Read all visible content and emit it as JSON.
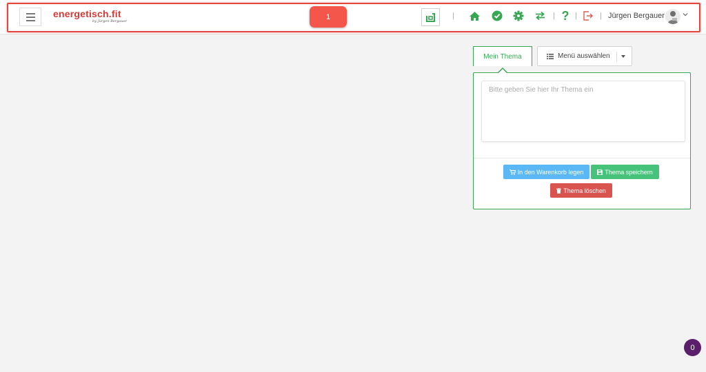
{
  "header": {
    "logo_main": "energetisch.fit",
    "logo_sub": "by Jürgen Bergauer",
    "red_badge": "1",
    "user_name": "Jürgen Bergauer",
    "separator": "|",
    "icons": [
      "menu-icon",
      "square-icon",
      "home-icon",
      "check-circle-icon",
      "gear-icon",
      "swap-icon",
      "question-icon",
      "logout-icon",
      "avatar",
      "chevron-down-icon"
    ]
  },
  "topic": {
    "tab_label": "Mein Thema",
    "menu_select_label": "Menü auswählen",
    "textarea_placeholder": "Bitte geben Sie hier Ihr Thema ein",
    "cart_button": "In den Warenkorb legen",
    "save_button": "Thema speichern",
    "delete_button": "Thema löschen"
  },
  "corner_badge": "0",
  "colors": {
    "accent_green": "#36a853",
    "logo_red": "#d63a35",
    "badge_red": "#f4564b",
    "cart_blue": "#5bb8f5",
    "save_green": "#46c27a",
    "delete_red": "#d9534f",
    "corner_purple": "#5a1e6b"
  }
}
